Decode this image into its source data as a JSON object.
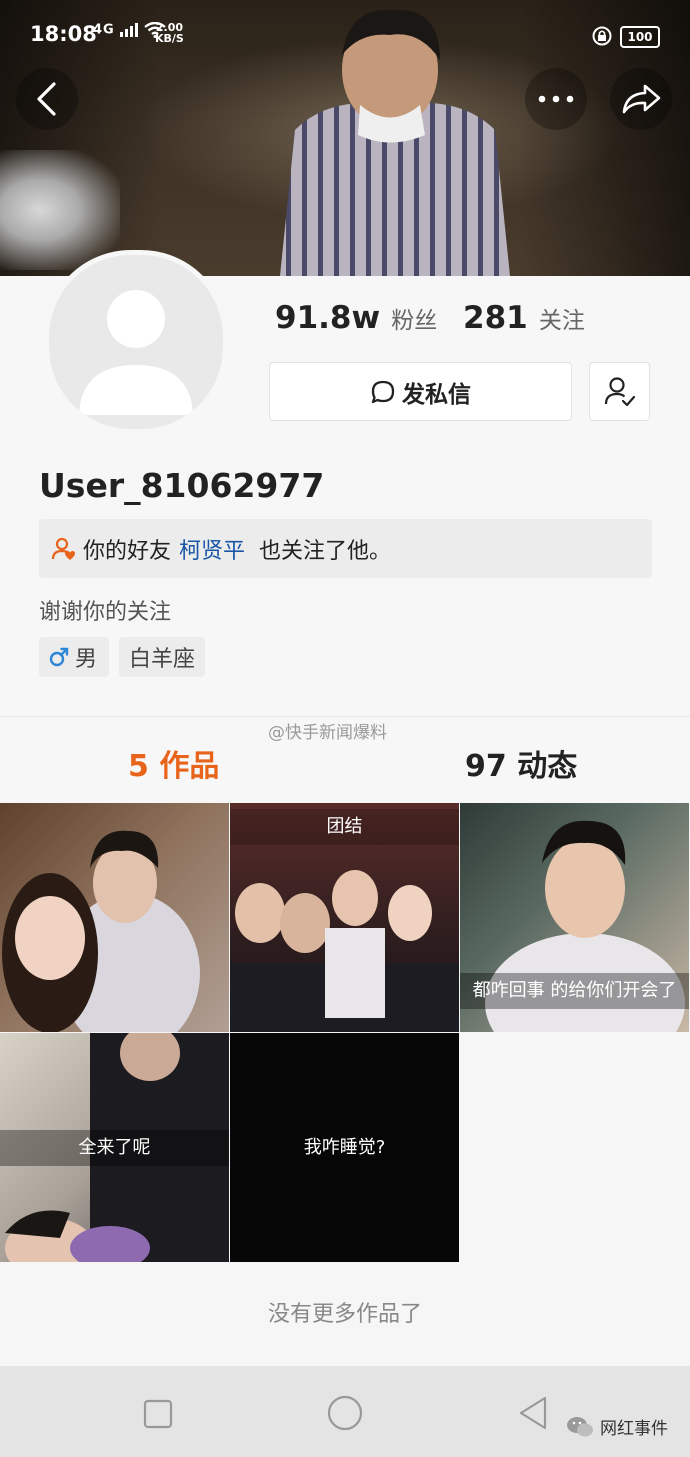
{
  "status_bar": {
    "time": "18:08",
    "network": "4G",
    "speed_top": "2.00",
    "speed_bottom": "KB/S",
    "battery": "100"
  },
  "stats": {
    "fans_num": "91.8w",
    "fans_label": "粉丝",
    "follow_num": "281",
    "follow_label": "关注"
  },
  "buttons": {
    "message_label": "发私信"
  },
  "user": {
    "name": "User_81062977",
    "bio": "谢谢你的关注",
    "gender": "男",
    "zodiac": "白羊座"
  },
  "friend_notice": {
    "prefix": "你的好友",
    "friend": "柯贤平",
    "suffix": "也关注了他。"
  },
  "tabs": {
    "works_count": "5",
    "works_label": "作品",
    "moments_count": "97",
    "moments_label": "动态"
  },
  "watermark": {
    "top": "@快手新闻爆料",
    "bottom": "网红事件"
  },
  "grid": {
    "captions": [
      "团结",
      "都咋回事 的给你们开会了",
      "全来了呢",
      "我咋睡觉?"
    ]
  },
  "footer": {
    "no_more": "没有更多作品了"
  },
  "colors": {
    "accent": "#e8641b",
    "friend_link": "#1a56a8"
  }
}
